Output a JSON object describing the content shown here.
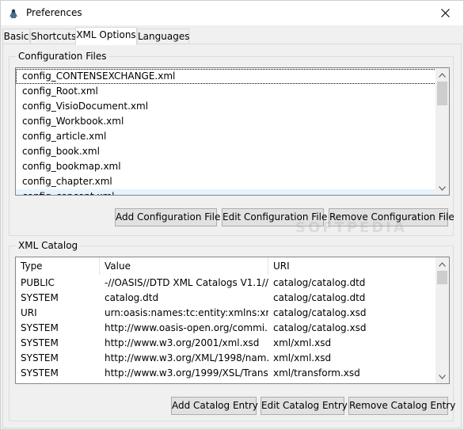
{
  "window": {
    "title": "Preferences"
  },
  "tabs": [
    {
      "label": "Basic"
    },
    {
      "label": "Shortcuts"
    },
    {
      "label": "XML Options"
    },
    {
      "label": "Languages"
    }
  ],
  "config_files": {
    "group_title": "Configuration Files",
    "items": [
      "config_CONTENSEXCHANGE.xml",
      "config_Root.xml",
      "config_VisioDocument.xml",
      "config_Workbook.xml",
      "config_article.xml",
      "config_book.xml",
      "config_bookmap.xml",
      "config_chapter.xml",
      "config_concept.xml"
    ],
    "buttons": {
      "add": "Add Configuration File",
      "edit": "Edit Configuration File",
      "remove": "Remove Configuration File"
    }
  },
  "xml_catalog": {
    "group_title": "XML Catalog",
    "columns": [
      "Type",
      "Value",
      "URI"
    ],
    "rows": [
      [
        "PUBLIC",
        "-//OASIS//DTD XML Catalogs V1.1//...",
        "catalog/catalog.dtd"
      ],
      [
        "SYSTEM",
        "catalog.dtd",
        "catalog/catalog.dtd"
      ],
      [
        "URI",
        "urn:oasis:names:tc:entity:xmlns:xml:...",
        "catalog/catalog.xsd"
      ],
      [
        "SYSTEM",
        "http://www.oasis-open.org/commi...",
        "catalog/catalog.xsd"
      ],
      [
        "SYSTEM",
        "http://www.w3.org/2001/xml.xsd",
        "xml/xml.xsd"
      ],
      [
        "SYSTEM",
        "http://www.w3.org/XML/1998/nam...",
        "xml/xml.xsd"
      ],
      [
        "SYSTEM",
        "http://www.w3.org/1999/XSL/Trans...",
        "xml/transform.xsd"
      ]
    ],
    "buttons": {
      "add": "Add Catalog Entry",
      "edit": "Edit Catalog Entry",
      "remove": "Remove Catalog Entry"
    }
  },
  "watermark": "SOFTPEDIA",
  "colors": {
    "focus_hover": "#e5f3ff",
    "button_face": "#e1e1e1",
    "scroll_thumb": "#cdcdcd"
  }
}
